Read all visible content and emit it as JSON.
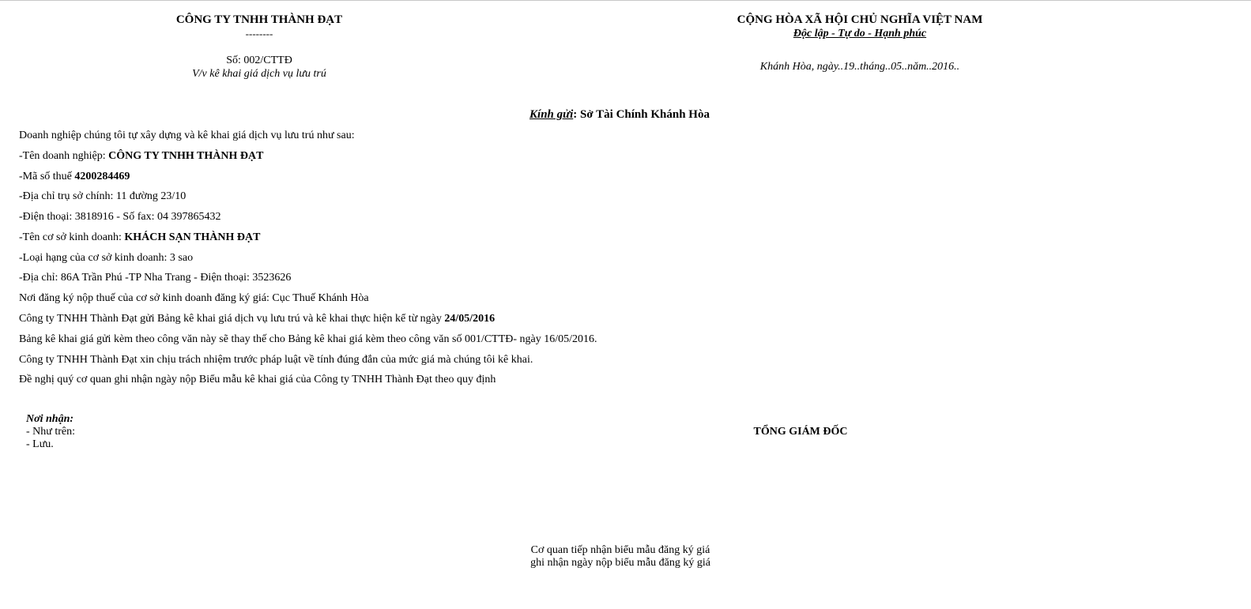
{
  "header_left": {
    "company": "CÔNG TY TNHH THÀNH ĐẠT",
    "dashes": "--------",
    "number": "Số: 002/CTTĐ",
    "subject": "V/v kê khai giá dịch vụ lưu trú"
  },
  "header_right": {
    "nation": "CỘNG HÒA XÃ HỘI CHỦ NGHĨA VIỆT NAM",
    "motto": "Độc lập - Tự do - Hạnh phúc",
    "date": "Khánh Hòa, ngày..19..tháng..05..năm..2016.."
  },
  "recipient": {
    "label": "Kính gửi",
    "separator": ": ",
    "name": "Sở Tài Chính Khánh Hòa"
  },
  "body": {
    "intro": "Doanh nghiệp chúng tôi tự xây dựng và kê khai giá dịch vụ lưu trú như sau:",
    "company_name_label": "-Tên doanh nghiệp: ",
    "company_name_value": "CÔNG TY TNHH THÀNH ĐẠT",
    "tax_code_label": "-Mã số thuế ",
    "tax_code_value": "4200284469",
    "address_main": "-Địa chỉ trụ sở chính: 11 đường 23/10",
    "phone_fax": "-Điện thoại: 3818916 - Số fax: 04 397865432",
    "business_name_label": "-Tên cơ sở kinh doanh: ",
    "business_name_value": "KHÁCH SẠN THÀNH ĐẠT",
    "business_class": "-Loại hạng của cơ sở kinh doanh: 3 sao",
    "business_address": "-Địa chỉ: 86A Trần Phú -TP Nha Trang - Điện thoại: 3523626",
    "tax_office": "Nơi đăng ký nộp thuế của cơ sở kinh doanh đăng ký giá: Cục Thuế Khánh Hòa",
    "effective_text": "Công ty TNHH Thành Đạt gửi Bảng kê khai giá dịch vụ lưu trú và kê khai thực hiện kể từ ngày ",
    "effective_date": "24/05/2016",
    "replace_text": "Bảng kê khai giá gửi kèm theo công văn này sẽ thay thế cho Bảng kê khai giá kèm theo công văn số 001/CTTĐ- ngày 16/05/2016.",
    "responsibility": "Công ty TNHH Thành Đạt xin chịu trách nhiệm trước pháp luật về tính đúng đắn của mức giá mà chúng tôi kê khai.",
    "request": "Đề nghị quý cơ quan ghi nhận ngày nộp Biểu mẫu kê khai giá của Công ty TNHH Thành Đạt theo quy định"
  },
  "footer": {
    "noi_nhan_label": "Nơi nhận:",
    "noi_nhan_item1": "- Như trên:",
    "noi_nhan_item2": "- Lưu.",
    "director": "TỔNG GIÁM ĐỐC",
    "receiving_line1": "Cơ quan tiếp nhận biểu mẫu đăng ký giá",
    "receiving_line2": "ghi nhận ngày nộp biểu mẫu đăng ký giá"
  }
}
